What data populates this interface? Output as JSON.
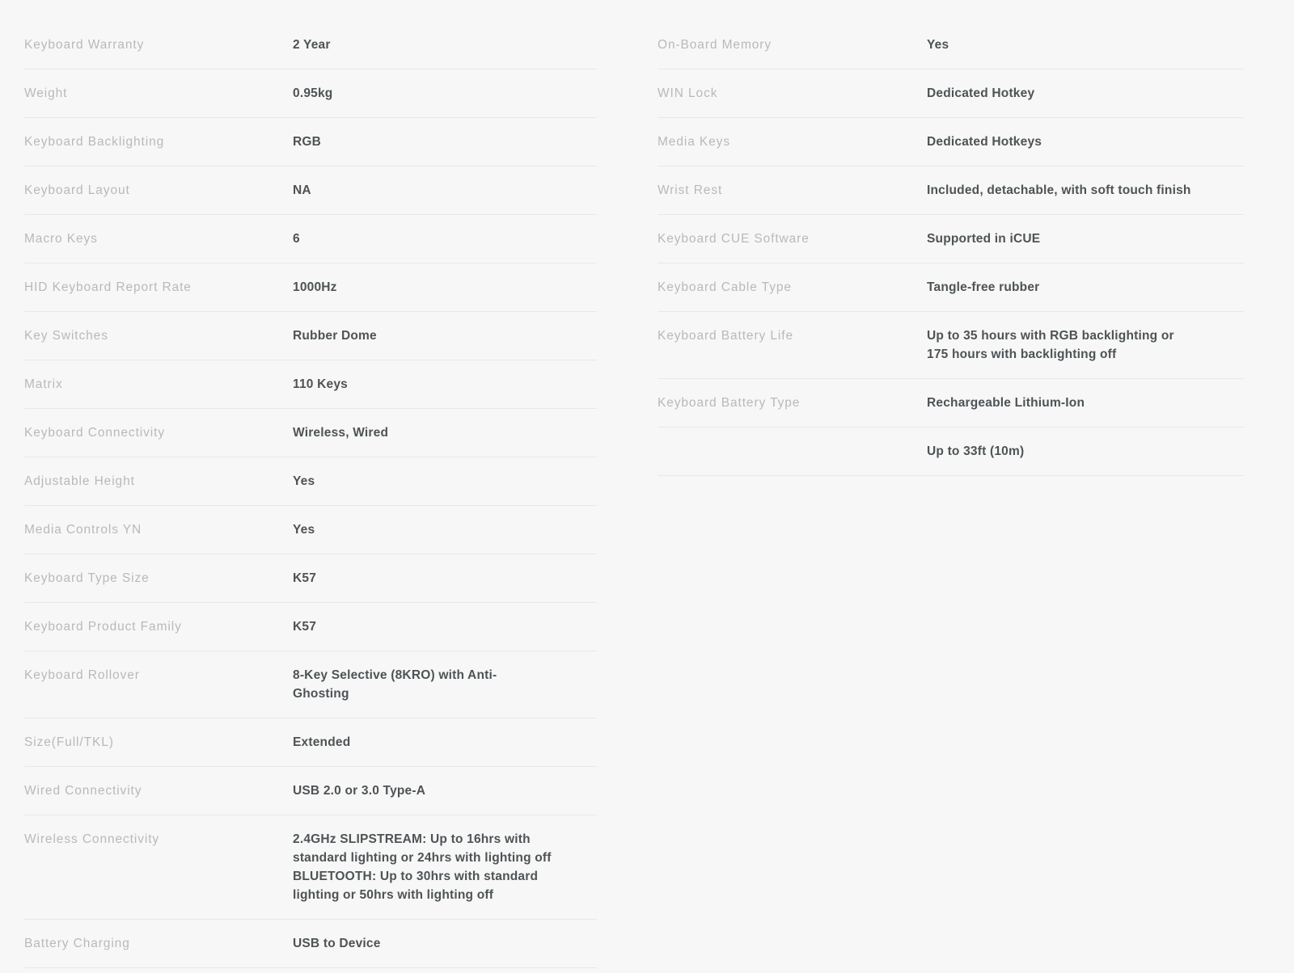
{
  "page": {
    "title": "Keyboard Product Specifications",
    "background_color": "#f7f7f7",
    "label_color": "#b9b9b9",
    "value_color": "#4e5355",
    "divider_color": "#e8e8e8"
  },
  "columns": {
    "left": {
      "name": "left-spec-column",
      "rows": [
        {
          "label": "Keyboard Warranty",
          "value": "2 Year"
        },
        {
          "label": "Weight",
          "value": "0.95kg"
        },
        {
          "label": "Keyboard Backlighting",
          "value": "RGB"
        },
        {
          "label": "Keyboard Layout",
          "value": "NA"
        },
        {
          "label": "Macro Keys",
          "value": "6"
        },
        {
          "label": "HID Keyboard Report Rate",
          "value": "1000Hz"
        },
        {
          "label": "Key Switches",
          "value": "Rubber Dome"
        },
        {
          "label": "Matrix",
          "value": "110 Keys"
        },
        {
          "label": "Keyboard Connectivity",
          "value": "Wireless, Wired"
        },
        {
          "label": "Adjustable Height",
          "value": "Yes"
        },
        {
          "label": "Media Controls YN",
          "value": "Yes"
        },
        {
          "label": "Keyboard Type Size",
          "value": "K57"
        },
        {
          "label": "Keyboard Product Family",
          "value": "K57"
        },
        {
          "label": "Keyboard Rollover",
          "value": "8-Key Selective (8KRO) with Anti-Ghosting"
        },
        {
          "label": "Size(Full/TKL)",
          "value": "Extended"
        },
        {
          "label": "Wired Connectivity",
          "value": "USB 2.0 or 3.0 Type-A"
        },
        {
          "label": "Wireless Connectivity",
          "value": "2.4GHz SLIPSTREAM: Up to 16hrs with standard lighting or 24hrs with lighting off BLUETOOTH: Up to 30hrs with standard lighting or 50hrs with lighting off"
        },
        {
          "label": "Battery Charging",
          "value": "USB to Device"
        }
      ]
    },
    "right": {
      "name": "right-spec-column",
      "rows": [
        {
          "label": "On-Board Memory",
          "value": "Yes"
        },
        {
          "label": "WIN Lock",
          "value": "Dedicated Hotkey"
        },
        {
          "label": "Media Keys",
          "value": "Dedicated Hotkeys"
        },
        {
          "label": "Wrist Rest",
          "value": "Included, detachable, with soft touch finish"
        },
        {
          "label": "Keyboard CUE Software",
          "value": "Supported in iCUE"
        },
        {
          "label": "Keyboard Cable Type",
          "value": "Tangle-free rubber"
        },
        {
          "label": "Keyboard Battery Life",
          "value": "Up to 35 hours with RGB backlighting or 175 hours with backlighting off"
        },
        {
          "label": "Keyboard Battery Type",
          "value": "Rechargeable Lithium-Ion"
        },
        {
          "label": "",
          "value": "Up to 33ft (10m)"
        }
      ]
    }
  }
}
